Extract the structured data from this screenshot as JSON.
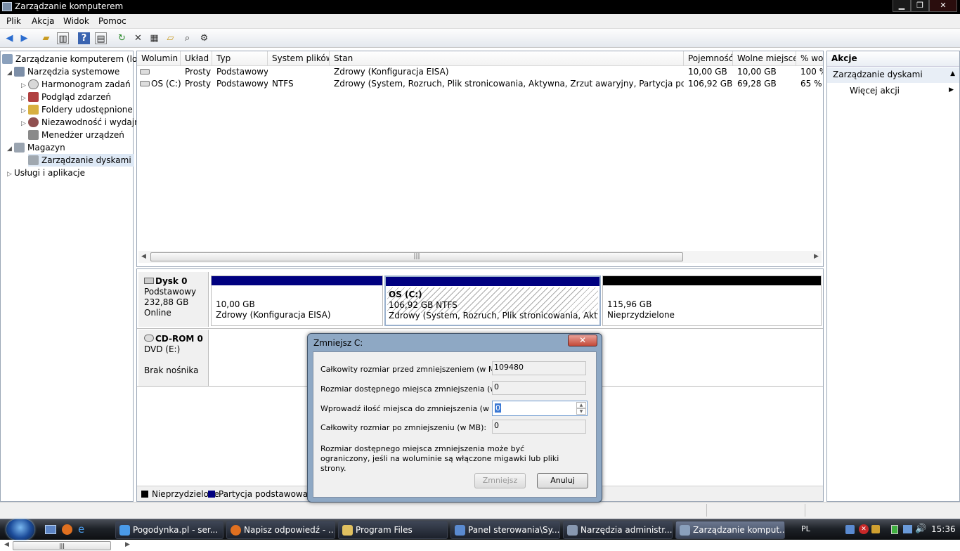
{
  "window": {
    "title": "Zarządzanie komputerem",
    "buttons": {
      "minimize": "▁",
      "restore": "❐",
      "close": "✕"
    }
  },
  "menu": [
    "Plik",
    "Akcja",
    "Widok",
    "Pomoc"
  ],
  "toolbar_icons": [
    "back-arrow-icon",
    "forward-arrow-icon",
    "folder-up-icon",
    "show-hide-tree-icon",
    "help-icon",
    "show-hide-action-pane-icon",
    "refresh-icon",
    "delete-icon",
    "properties-icon",
    "open-icon",
    "search-icon",
    "settings-icon"
  ],
  "tree": {
    "root": "Zarządzanie komputerem (loka",
    "system_tools": "Narzędzia systemowe",
    "scheduler": "Harmonogram zadań",
    "event_viewer": "Podgląd zdarzeń",
    "shared_folders": "Foldery udostępnione",
    "reliability": "Niezawodność i wydajn",
    "device_manager": "Menedżer urządzeń",
    "storage": "Magazyn",
    "disk_management": "Zarządzanie dyskami",
    "services": "Usługi i aplikacje"
  },
  "volume_list": {
    "columns": [
      "Wolumin",
      "Układ",
      "Typ",
      "System plików",
      "Stan",
      "Pojemność",
      "Wolne miejsce",
      "% wol"
    ],
    "rows": [
      {
        "volume": "",
        "layout": "Prosty",
        "type": "Podstawowy",
        "fs": "",
        "status": "Zdrowy (Konfiguracja EISA)",
        "capacity": "10,00 GB",
        "free": "10,00 GB",
        "pct": "100 %"
      },
      {
        "volume": "OS (C:)",
        "layout": "Prosty",
        "type": "Podstawowy",
        "fs": "NTFS",
        "status": "Zdrowy (System, Rozruch, Plik stronicowania, Aktywna, Zrzut awaryjny, Partycja podstawowa)",
        "capacity": "106,92 GB",
        "free": "69,28 GB",
        "pct": "65 %"
      }
    ]
  },
  "disks": {
    "disk0": {
      "name": "Dysk 0",
      "type": "Podstawowy",
      "size": "232,88 GB",
      "state": "Online",
      "partitions": [
        {
          "name": "",
          "size": "10,00 GB",
          "status": "Zdrowy (Konfiguracja EISA)"
        },
        {
          "name": "OS  (C:)",
          "size": "106,92 GB NTFS",
          "status": "Zdrowy (System, Rozruch, Plik stronicowania, Aktywna,"
        },
        {
          "name": "",
          "size": "115,96 GB",
          "status": "Nieprzydzielone"
        }
      ]
    },
    "cdrom0": {
      "name": "CD-ROM 0",
      "type": "DVD (E:)",
      "state": "Brak nośnika"
    }
  },
  "legend": {
    "unallocated": "Nieprzydzielone",
    "primary": "Partycja podstawowa"
  },
  "colors": {
    "primary": "#000080",
    "unallocated": "#000000",
    "selection": "#dde8f5"
  },
  "actions": {
    "header": "Akcje",
    "section": "Zarządzanie dyskami",
    "more": "Więcej akcji"
  },
  "dialog": {
    "title": "Zmniejsz C:",
    "close": "✕",
    "total_before_label": "Całkowity rozmiar przed zmniejszeniem (w MB):",
    "total_before_value": "109480",
    "available_label": "Rozmiar dostępnego miejsca zmniejszenia (w MB):",
    "available_value": "0",
    "enter_label": "Wprowadź ilość miejsca do zmniejszenia (w MB):",
    "enter_value": "0",
    "total_after_label": "Całkowity rozmiar po zmniejszeniu (w MB):",
    "total_after_value": "0",
    "note": "Rozmiar dostępnego miejsca zmniejszenia może być ograniczony, jeśli na woluminie są włączone migawki lub pliki strony.",
    "shrink_button": "Zmniejsz",
    "cancel_button": "Anuluj"
  },
  "taskbar": {
    "tasks": [
      "Pogodynka.pl - ser...",
      "Napisz odpowiedź - ...",
      "Program Files",
      "Panel sterowania\\Sy...",
      "Narzędzia administr...",
      "Zarządzanie komput..."
    ],
    "language": "PL",
    "clock": "15:36"
  }
}
